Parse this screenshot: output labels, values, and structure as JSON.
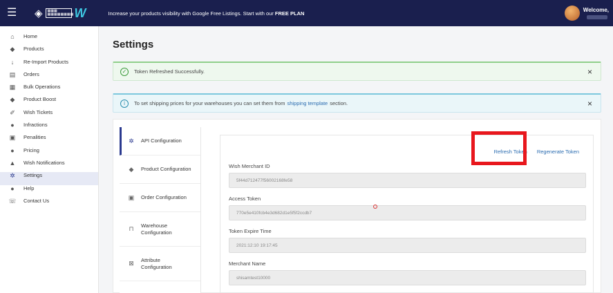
{
  "topbar": {
    "banner_text": "Increase your products visibility with Google Free Listings. Start with our",
    "banner_bold": "FREE PLAN",
    "welcome": "Welcome,",
    "logo_box_line1": "▦▦▦",
    "logo_box_line2": "▦▦▦▦▦▦▦▦",
    "logo_w": "W"
  },
  "sidebar": {
    "items": [
      {
        "label": "Home",
        "icon": "home-icon",
        "glyph": "⌂"
      },
      {
        "label": "Products",
        "icon": "tag-icon",
        "glyph": "◆"
      },
      {
        "label": "Re-Import Products",
        "icon": "download-icon",
        "glyph": "↓"
      },
      {
        "label": "Orders",
        "icon": "orders-icon",
        "glyph": "▤"
      },
      {
        "label": "Bulk Operations",
        "icon": "bulk-icon",
        "glyph": "▦"
      },
      {
        "label": "Product Boost",
        "icon": "boost-icon",
        "glyph": "◆"
      },
      {
        "label": "Wish Tickets",
        "icon": "ticket-icon",
        "glyph": "✐"
      },
      {
        "label": "Infractions",
        "icon": "info-icon",
        "glyph": "●"
      },
      {
        "label": "Penalities",
        "icon": "penalty-icon",
        "glyph": "▣"
      },
      {
        "label": "Pricing",
        "icon": "pricing-icon",
        "glyph": "●"
      },
      {
        "label": "Wish Notifications",
        "icon": "bell-icon",
        "glyph": "▲"
      },
      {
        "label": "Settings",
        "icon": "gear-icon",
        "glyph": "✲"
      },
      {
        "label": "Help",
        "icon": "help-icon",
        "glyph": "●"
      },
      {
        "label": "Contact Us",
        "icon": "contact-icon",
        "glyph": "☏"
      }
    ]
  },
  "page": {
    "title": "Settings"
  },
  "alerts": {
    "success": {
      "text": "Token Refreshed Successfully.",
      "icon": "check-circle-icon",
      "glyph": "✓"
    },
    "info": {
      "text_before": "To set shipping prices for your warehouses you can set them from",
      "link": "shipping template",
      "text_after": "section.",
      "icon": "info-circle-icon",
      "glyph": "i"
    },
    "close_glyph": "×"
  },
  "tabs": [
    {
      "label": "API Configuration",
      "icon": "api-icon",
      "glyph": "✲"
    },
    {
      "label": "Product Configuration",
      "icon": "product-tag-icon",
      "glyph": "◆"
    },
    {
      "label": "Order Configuration",
      "icon": "order-icon",
      "glyph": "▣"
    },
    {
      "label": "Warehouse Configuration",
      "line1": "Warehouse",
      "line2": "Configuration",
      "icon": "warehouse-icon",
      "glyph": "⊓"
    },
    {
      "label": "Attribute Configuration",
      "line1": "Attribute",
      "line2": "Configuration",
      "icon": "attribute-icon",
      "glyph": "⊠"
    }
  ],
  "form": {
    "refresh_token": "Refresh Token",
    "regenerate_token": "Regenerate Token",
    "fields": [
      {
        "label": "Wish Merchant ID",
        "value": "5f44d712477f56002168fe58"
      },
      {
        "label": "Access Token",
        "value": "770e5e410fcb4e3d682d1e5f5f2ccdb7"
      },
      {
        "label": "Token Expire Time",
        "value": "2021:12:10 19:17:45"
      },
      {
        "label": "Merchant Name",
        "value": "shisamtest10000"
      }
    ]
  },
  "colors": {
    "topbar": "#1a1f4e",
    "accent": "#2b3a8f",
    "highlight": "#e8171d"
  }
}
